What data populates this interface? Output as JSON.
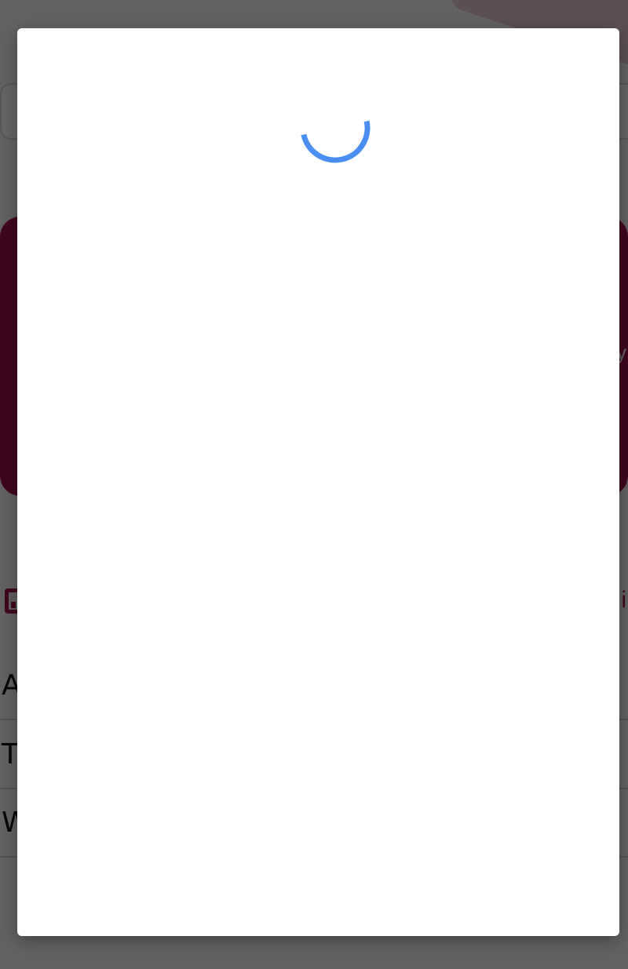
{
  "background": {
    "banner_text": "y",
    "tab_label_right": "i",
    "rows": [
      {
        "label": "A"
      },
      {
        "label": "T"
      },
      {
        "label": "W"
      }
    ]
  },
  "modal": {
    "state": "loading",
    "spinner_icon": "loading-spinner-icon"
  },
  "colors": {
    "brand": "#a3104f",
    "spinner": "#4a8ef2",
    "overlay": "rgba(0,0,0,0.6)"
  }
}
